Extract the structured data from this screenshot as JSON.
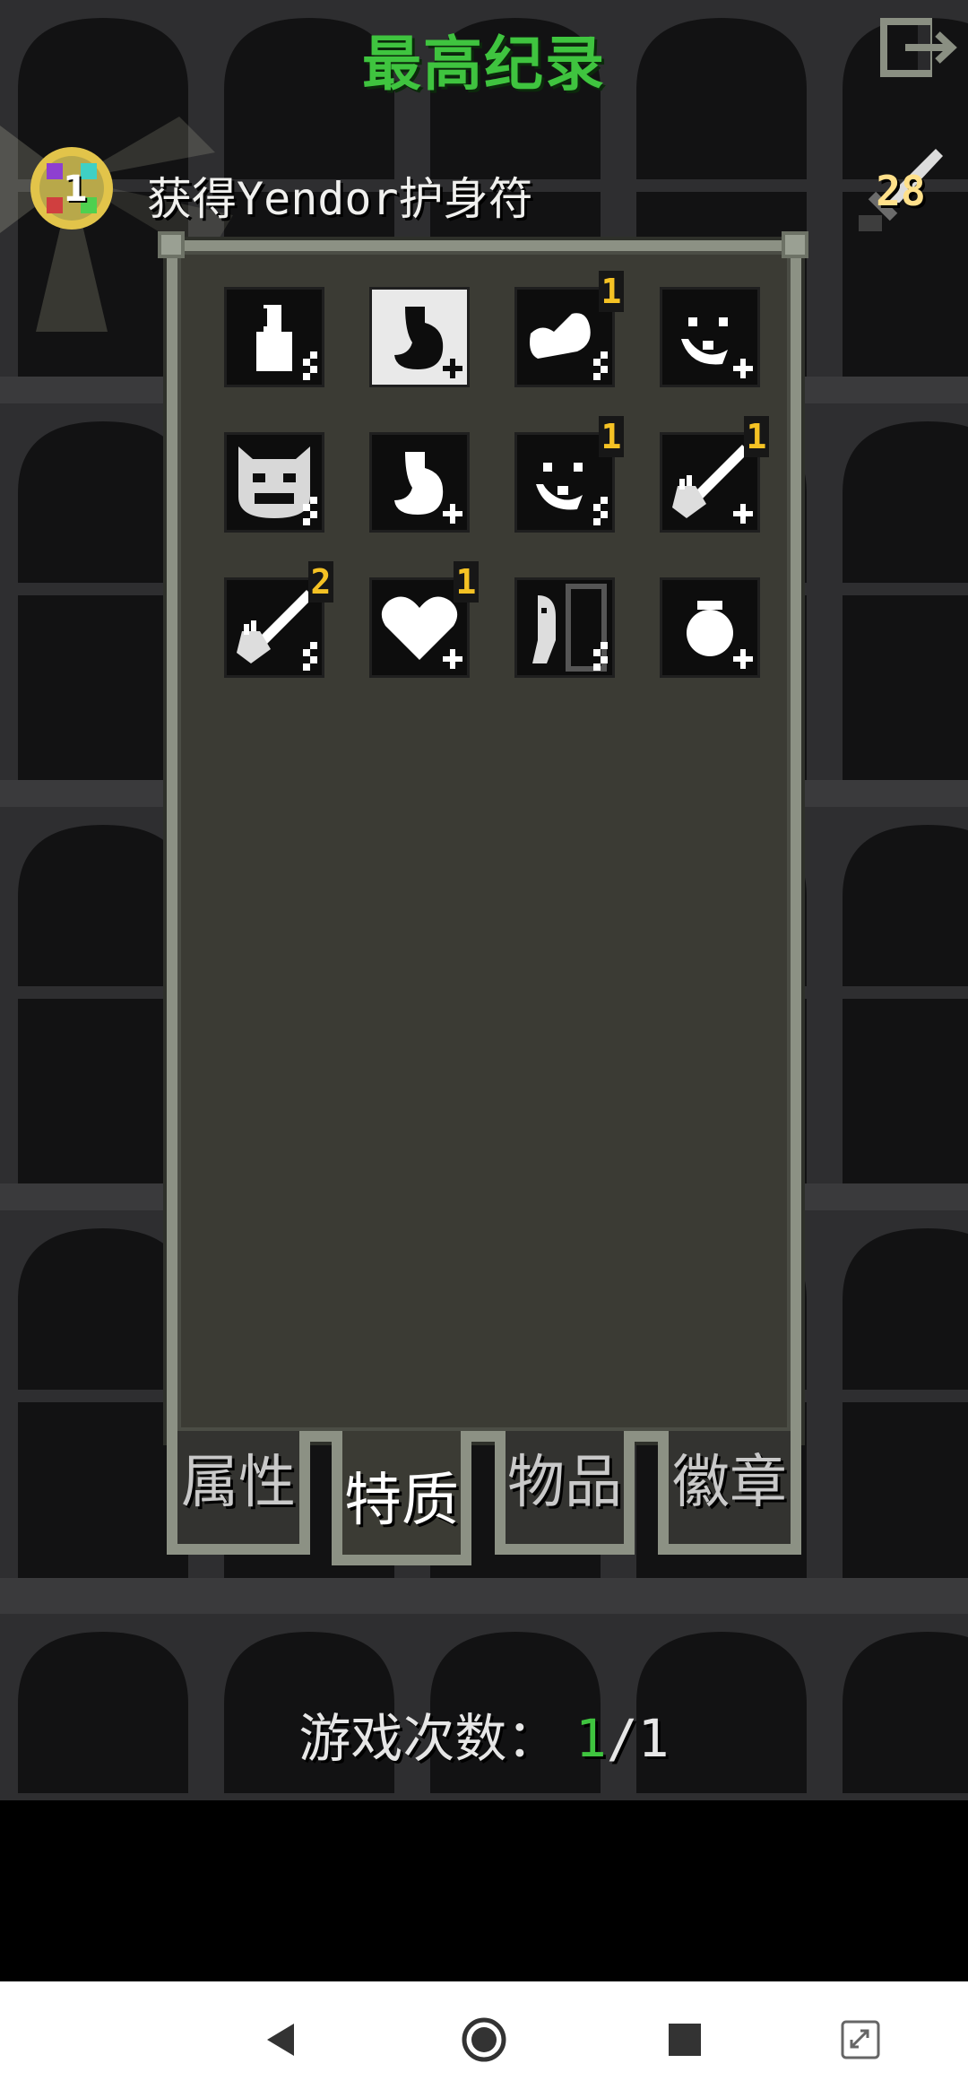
{
  "header": {
    "title": "最高纪录",
    "goal_text": "获得Yendor护身符",
    "amulet_count": "1",
    "depth": "28"
  },
  "traits": [
    {
      "icon": "bottle-icon",
      "badge": ""
    },
    {
      "icon": "stomach-icon",
      "badge": "",
      "highlighted": true
    },
    {
      "icon": "muscle-icon",
      "badge": "1"
    },
    {
      "icon": "smile-face-icon",
      "badge": ""
    },
    {
      "icon": "devil-mask-icon",
      "badge": ""
    },
    {
      "icon": "stomach-icon",
      "badge": ""
    },
    {
      "icon": "smile-face-icon",
      "badge": "1"
    },
    {
      "icon": "sword-hand-icon",
      "badge": "1"
    },
    {
      "icon": "sword-hand-icon",
      "badge": "2"
    },
    {
      "icon": "heart-icon",
      "badge": "1"
    },
    {
      "icon": "ghost-door-icon",
      "badge": ""
    },
    {
      "icon": "pot-icon",
      "badge": ""
    }
  ],
  "tabs": [
    {
      "label": "属性",
      "active": false
    },
    {
      "label": "特质",
      "active": true
    },
    {
      "label": "物品",
      "active": false
    },
    {
      "label": "徽章",
      "active": false
    }
  ],
  "footer": {
    "games_label": "游戏次数：",
    "games_current": "1",
    "games_total": "/1"
  },
  "colors": {
    "title_green": "#3fc43f",
    "badge_gold": "#f5c224",
    "panel_bg": "#3b3b34",
    "panel_border": "#8c9184"
  }
}
